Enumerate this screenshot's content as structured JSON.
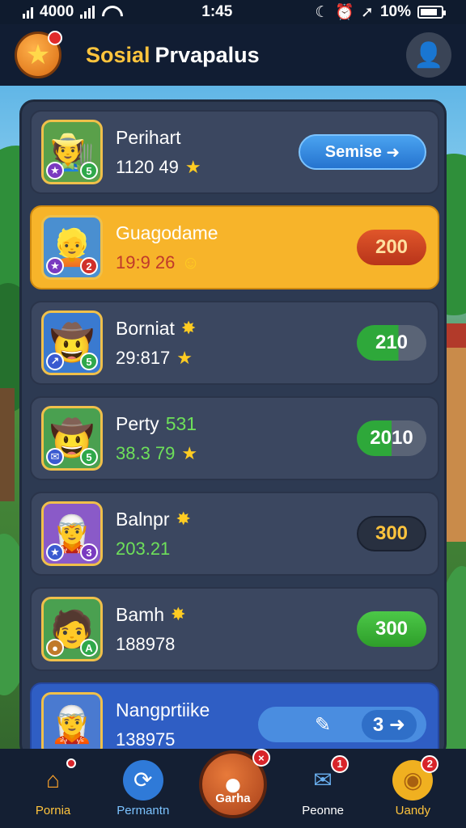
{
  "status": {
    "signal_text": "4000",
    "time": "1:45",
    "battery": "10%"
  },
  "header": {
    "title_part1": "Sosial",
    "title_part2": "Prvapalus",
    "logo_icon": "star-icon",
    "profile_icon": "profile-icon"
  },
  "rows": [
    {
      "name": "Perihart",
      "score": "1120 49",
      "action": "Semise",
      "action_icon": "arrow-right-icon",
      "rank_left": "",
      "rank_right": "5",
      "pill": "serve"
    },
    {
      "name": "Guagodame",
      "score": "19:9 26",
      "action": "200",
      "rank_left": "",
      "rank_right": "2",
      "pill": "red"
    },
    {
      "name": "Borniat",
      "score": "29:817",
      "action": "210",
      "rank_left": "",
      "rank_right": "5",
      "pill": "green"
    },
    {
      "name": "Perty",
      "name_extra": "531",
      "score": "38.3 79",
      "action": "2010",
      "rank_left": "",
      "rank_right": "5",
      "pill": "green2"
    },
    {
      "name": "Balnpr",
      "score": "203.21",
      "action": "300",
      "rank_left": "",
      "rank_right": "3",
      "pill": "dark"
    },
    {
      "name": "Bamh",
      "score": "188978",
      "action": "300",
      "rank_left": "",
      "rank_right": "A",
      "pill": "full"
    },
    {
      "name": "Nangprtiike",
      "score": "138975",
      "action": "3",
      "rank_left": "",
      "rank_right": "",
      "pill": "last"
    }
  ],
  "nav": [
    {
      "label": "Pornia",
      "icon": "home-icon",
      "badge": ""
    },
    {
      "label": "Permantn",
      "icon": "refresh-icon",
      "badge": ""
    },
    {
      "label": "Garha",
      "icon": "play-icon",
      "badge": ""
    },
    {
      "label": "Peonne",
      "icon": "mail-icon",
      "badge": "1"
    },
    {
      "label": "Uandy",
      "icon": "coin-icon",
      "badge": "2"
    }
  ]
}
